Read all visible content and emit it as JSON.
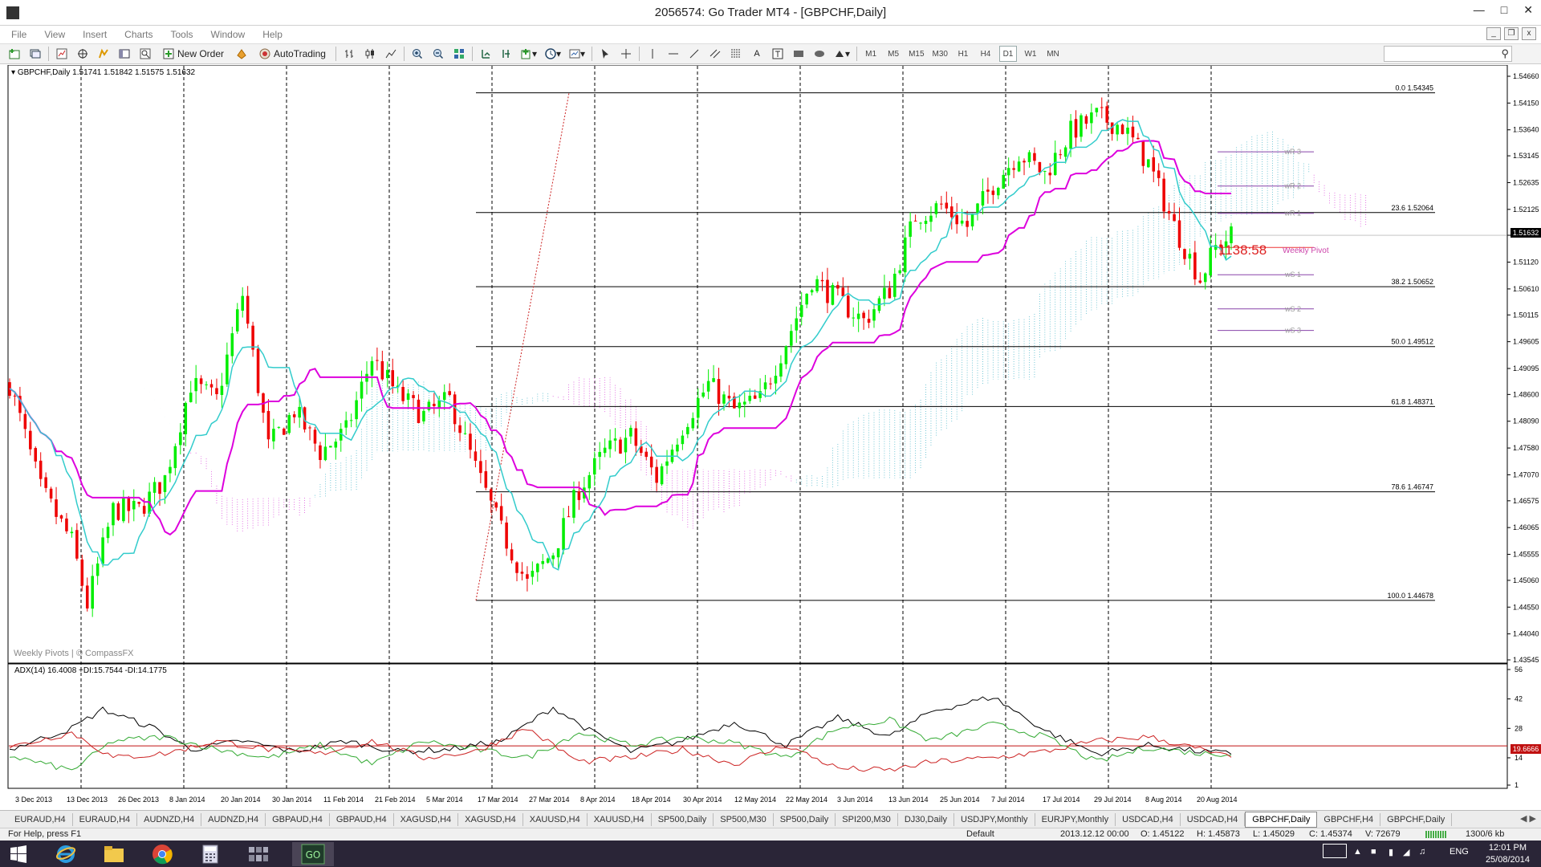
{
  "window": {
    "title": "2056574: Go Trader MT4 - [GBPCHF,Daily]"
  },
  "menu": [
    "File",
    "View",
    "Insert",
    "Charts",
    "Tools",
    "Window",
    "Help"
  ],
  "toolbar": {
    "new_order": "New Order",
    "autotrading": "AutoTrading",
    "timeframes": [
      "M1",
      "M5",
      "M15",
      "M30",
      "H1",
      "H4",
      "D1",
      "W1",
      "MN"
    ],
    "active_timeframe": "D1"
  },
  "chart_header": {
    "symbol": "GBPCHF,Daily",
    "prices": "1.51741 1.51842 1.51575 1.51632"
  },
  "watermark": "Weekly Pivots | © CompassFX",
  "current_price": "1.51632",
  "timer_text": "1138:58",
  "weekly_pivot_label": "Weekly Pivot",
  "colors": {
    "bull": "#00ee00",
    "bear": "#ee0000",
    "kijun": "#dd00dd",
    "tenkan": "#33cccc",
    "pivot": "#8844aa",
    "adx_main": "#000000",
    "plus_di": "#33aa33",
    "minus_di": "#cc2222"
  },
  "indicator_header": "ADX(14) 16.4008 +DI:15.7544 -DI:14.1775",
  "adx_level_label": "19.6666",
  "chart_data": [
    {
      "type": "candlestick",
      "title": "GBPCHF,Daily",
      "ylim": [
        1.43545,
        1.5466
      ],
      "price_axis_labels": [
        "1.54660",
        "1.54150",
        "1.53640",
        "1.53145",
        "1.52635",
        "1.52125",
        "1.51632",
        "1.51120",
        "1.50610",
        "1.50115",
        "1.49605",
        "1.49095",
        "1.48600",
        "1.48090",
        "1.47580",
        "1.47070",
        "1.46575",
        "1.46065",
        "1.45555",
        "1.45060",
        "1.44550",
        "1.44040",
        "1.43545"
      ],
      "date_axis_labels": [
        "3 Dec 2013",
        "13 Dec 2013",
        "26 Dec 2013",
        "8 Jan 2014",
        "20 Jan 2014",
        "30 Jan 2014",
        "11 Feb 2014",
        "21 Feb 2014",
        "5 Mar 2014",
        "17 Mar 2014",
        "27 Mar 2014",
        "8 Apr 2014",
        "18 Apr 2014",
        "30 Apr 2014",
        "12 May 2014",
        "22 May 2014",
        "3 Jun 2014",
        "13 Jun 2014",
        "25 Jun 2014",
        "7 Jul 2014",
        "17 Jul 2014",
        "29 Jul 2014",
        "8 Aug 2014",
        "20 Aug 2014"
      ],
      "fibonacci": [
        {
          "label": "0.0",
          "value": 1.54345
        },
        {
          "label": "23.6",
          "value": 1.52064
        },
        {
          "label": "38.2",
          "value": 1.50652
        },
        {
          "label": "50.0",
          "value": 1.49512
        },
        {
          "label": "61.8",
          "value": 1.48371
        },
        {
          "label": "78.6",
          "value": 1.46747
        },
        {
          "label": "100.0",
          "value": 1.44678
        }
      ],
      "weekly_pivots": [
        {
          "label": "wR 3",
          "value": 1.5322
        },
        {
          "label": "wR 2",
          "value": 1.5257
        },
        {
          "label": "wR 1",
          "value": 1.5205
        },
        {
          "label": "Weekly Pivot",
          "value": 1.514
        },
        {
          "label": "wS 1",
          "value": 1.5088
        },
        {
          "label": "wS 2",
          "value": 1.5023
        },
        {
          "label": "wS 3",
          "value": 1.4982
        }
      ],
      "close_path": [
        [
          0,
          1.488
        ],
        [
          6,
          1.468
        ],
        [
          12,
          1.458
        ],
        [
          15,
          1.446
        ],
        [
          20,
          1.464
        ],
        [
          25,
          1.464
        ],
        [
          30,
          1.47
        ],
        [
          35,
          1.488
        ],
        [
          40,
          1.485
        ],
        [
          45,
          1.505
        ],
        [
          50,
          1.476
        ],
        [
          55,
          1.483
        ],
        [
          60,
          1.475
        ],
        [
          65,
          1.479
        ],
        [
          70,
          1.493
        ],
        [
          75,
          1.486
        ],
        [
          80,
          1.482
        ],
        [
          85,
          1.485
        ],
        [
          90,
          1.472
        ],
        [
          95,
          1.46
        ],
        [
          100,
          1.45
        ],
        [
          105,
          1.456
        ],
        [
          110,
          1.468
        ],
        [
          115,
          1.475
        ],
        [
          120,
          1.478
        ],
        [
          125,
          1.47
        ],
        [
          130,
          1.48
        ],
        [
          135,
          1.488
        ],
        [
          140,
          1.483
        ],
        [
          145,
          1.485
        ],
        [
          150,
          1.496
        ],
        [
          155,
          1.508
        ],
        [
          160,
          1.504
        ],
        [
          165,
          1.5
        ],
        [
          170,
          1.506
        ],
        [
          175,
          1.52
        ],
        [
          180,
          1.522
        ],
        [
          185,
          1.518
        ],
        [
          190,
          1.526
        ],
        [
          195,
          1.532
        ],
        [
          200,
          1.528
        ],
        [
          205,
          1.536
        ],
        [
          210,
          1.539
        ],
        [
          215,
          1.537
        ],
        [
          220,
          1.53
        ],
        [
          225,
          1.518
        ],
        [
          230,
          1.508
        ],
        [
          233,
          1.514
        ],
        [
          236,
          1.5163
        ]
      ]
    },
    {
      "type": "line",
      "title": "ADX(14) 16.4008 +DI:15.7544 -DI:14.1775",
      "ylim": [
        1,
        56
      ],
      "y_axis_labels": [
        "56",
        "42",
        "28",
        "14",
        "1"
      ],
      "level": 19.6666,
      "series": [
        {
          "name": "ADX(14)",
          "values": [
            [
              0,
              18
            ],
            [
              12,
              28
            ],
            [
              18,
              37
            ],
            [
              28,
              28
            ],
            [
              35,
              18
            ],
            [
              45,
              22
            ],
            [
              55,
              17
            ],
            [
              65,
              22
            ],
            [
              75,
              17
            ],
            [
              85,
              18
            ],
            [
              95,
              22
            ],
            [
              105,
              38
            ],
            [
              112,
              27
            ],
            [
              120,
              17
            ],
            [
              130,
              22
            ],
            [
              140,
              31
            ],
            [
              150,
              20
            ],
            [
              160,
              33
            ],
            [
              170,
              24
            ],
            [
              178,
              36
            ],
            [
              190,
              43
            ],
            [
              200,
              27
            ],
            [
              210,
              16
            ],
            [
              220,
              20
            ],
            [
              230,
              17
            ],
            [
              236,
              16
            ]
          ]
        },
        {
          "name": "+DI",
          "values": [
            [
              0,
              15
            ],
            [
              12,
              8
            ],
            [
              20,
              22
            ],
            [
              30,
              24
            ],
            [
              40,
              18
            ],
            [
              50,
              14
            ],
            [
              60,
              20
            ],
            [
              70,
              11
            ],
            [
              80,
              22
            ],
            [
              90,
              18
            ],
            [
              100,
              14
            ],
            [
              110,
              26
            ],
            [
              120,
              20
            ],
            [
              130,
              24
            ],
            [
              140,
              21
            ],
            [
              150,
              14
            ],
            [
              160,
              28
            ],
            [
              170,
              32
            ],
            [
              178,
              22
            ],
            [
              190,
              30
            ],
            [
              200,
              24
            ],
            [
              210,
              12
            ],
            [
              220,
              19
            ],
            [
              230,
              16
            ],
            [
              236,
              16
            ]
          ]
        },
        {
          "name": "-DI",
          "values": [
            [
              0,
              19
            ],
            [
              12,
              26
            ],
            [
              20,
              14
            ],
            [
              30,
              16
            ],
            [
              40,
              22
            ],
            [
              50,
              18
            ],
            [
              60,
              16
            ],
            [
              70,
              22
            ],
            [
              80,
              14
            ],
            [
              90,
              17
            ],
            [
              100,
              28
            ],
            [
              110,
              12
            ],
            [
              120,
              14
            ],
            [
              130,
              18
            ],
            [
              140,
              11
            ],
            [
              150,
              20
            ],
            [
              160,
              9
            ],
            [
              170,
              8
            ],
            [
              178,
              12
            ],
            [
              190,
              14
            ],
            [
              200,
              17
            ],
            [
              210,
              22
            ],
            [
              220,
              24
            ],
            [
              230,
              18
            ],
            [
              236,
              14
            ]
          ]
        }
      ]
    }
  ],
  "symbol_tabs": [
    "EURAUD,H4",
    "EURAUD,H4",
    "AUDNZD,H4",
    "AUDNZD,H4",
    "GBPAUD,H4",
    "GBPAUD,H4",
    "XAGUSD,H4",
    "XAGUSD,H4",
    "XAUUSD,H4",
    "XAUUSD,H4",
    "SP500,Daily",
    "SP500,M30",
    "SP500,Daily",
    "SPI200,M30",
    "DJ30,Daily",
    "USDJPY,Monthly",
    "EURJPY,Monthly",
    "USDCAD,H4",
    "USDCAD,H4",
    "GBPCHF,Daily",
    "GBPCHF,H4",
    "GBPCHF,Daily"
  ],
  "active_tab_index": 19,
  "status": {
    "help": "For Help, press F1",
    "profile": "Default",
    "datetime": "2013.12.12 00:00",
    "open": "O: 1.45122",
    "high": "H: 1.45873",
    "low": "L: 1.45029",
    "close": "C: 1.45374",
    "volume": "V: 72679",
    "traffic": "1300/6 kb"
  },
  "taskbar": {
    "language": "ENG",
    "time": "12:01 PM",
    "date": "25/08/2014"
  }
}
